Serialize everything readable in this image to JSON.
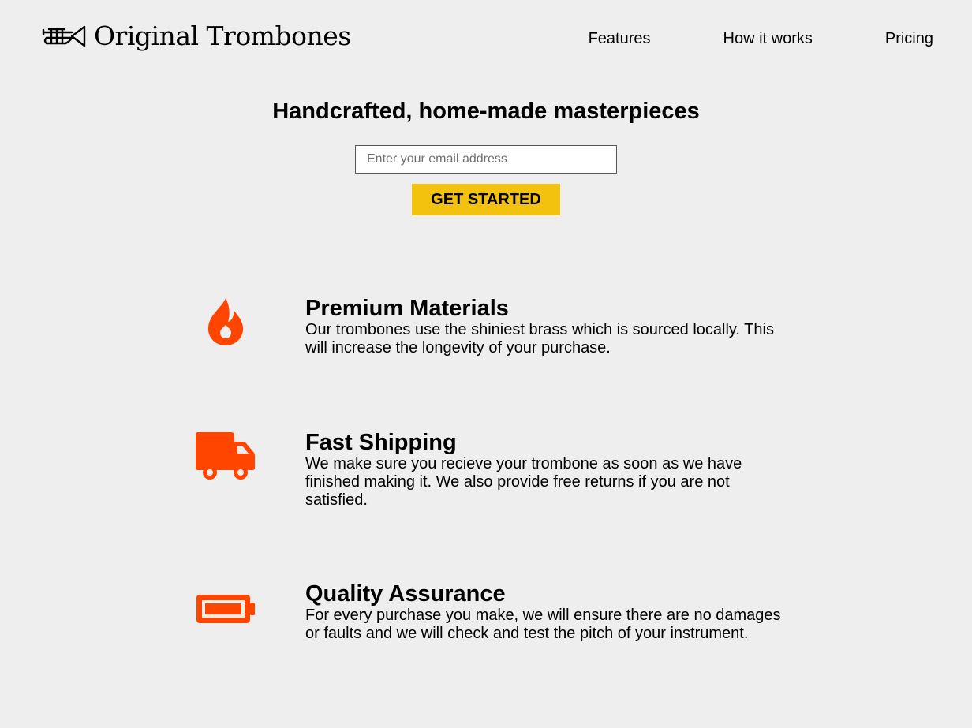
{
  "header": {
    "logo_text": "Original Trombones",
    "nav": [
      {
        "label": "Features"
      },
      {
        "label": "How it works"
      },
      {
        "label": "Pricing"
      }
    ]
  },
  "hero": {
    "title": "Handcrafted, home-made masterpieces",
    "email_placeholder": "Enter your email address",
    "email_value": "",
    "cta_label": "GET STARTED"
  },
  "features": [
    {
      "icon": "fire-icon",
      "title": "Premium Materials",
      "description": "Our trombones use the shiniest brass which is sourced locally. This will increase the longevity of your purchase."
    },
    {
      "icon": "truck-icon",
      "title": "Fast Shipping",
      "description": "We make sure you recieve your trombone as soon as we have finished making it. We also provide free returns if you are not satisfied."
    },
    {
      "icon": "battery-icon",
      "title": "Quality Assurance",
      "description": "For every purchase you make, we will ensure there are no damages or faults and we will check and test the pitch of your instrument."
    }
  ],
  "colors": {
    "background": "#eeeeee",
    "accent": "#f2c20f",
    "icon": "#ff4500"
  }
}
